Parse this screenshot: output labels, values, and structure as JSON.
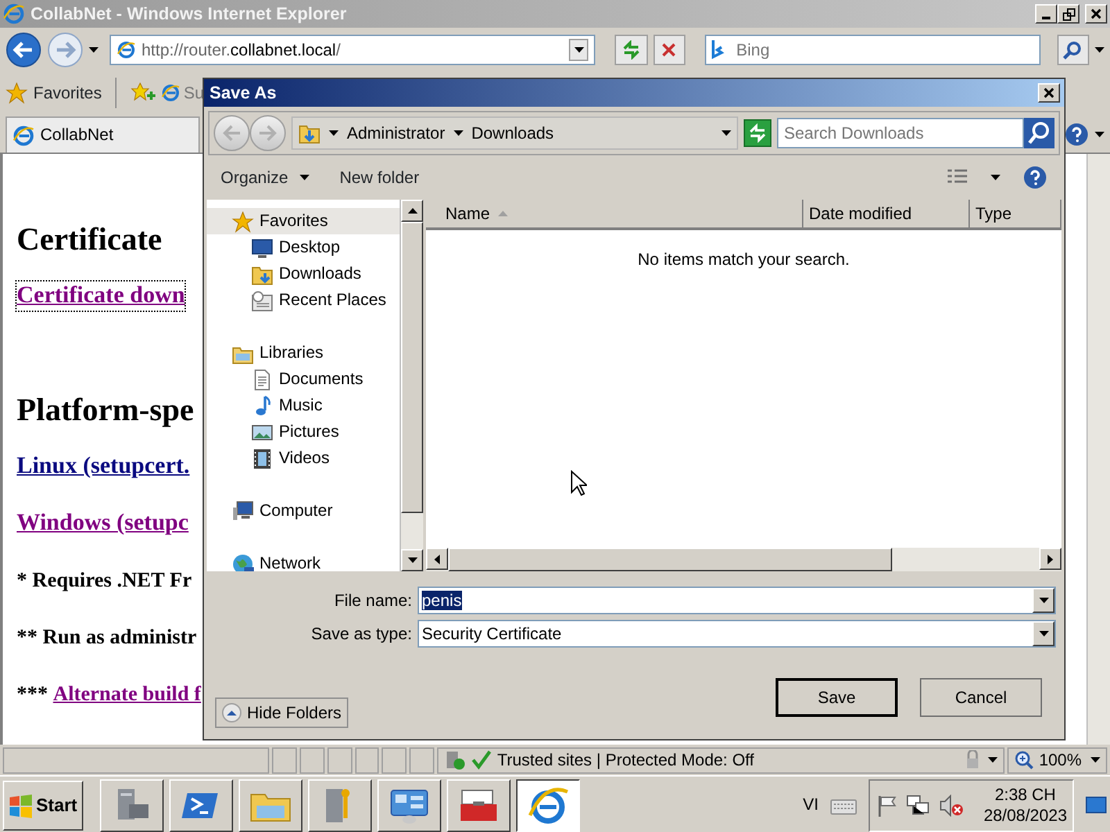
{
  "window": {
    "title": "CollabNet - Windows Internet Explorer"
  },
  "address_bar": {
    "url_prefix": "http://router.",
    "url_domain": "collabnet.local",
    "url_suffix": "/"
  },
  "search": {
    "placeholder": "Bing"
  },
  "favorites_bar": {
    "label": "Favorites",
    "items": [
      "Su"
    ]
  },
  "tabs": [
    {
      "label": "CollabNet",
      "selected": true
    }
  ],
  "page": {
    "blocks": [
      {
        "kind": "heading",
        "text": "Certificate"
      },
      {
        "kind": "link",
        "text": "Certificate down",
        "visited": true,
        "focused": true
      },
      {
        "kind": "heading",
        "text": "Platform-spe"
      },
      {
        "kind": "link",
        "text": "Linux (setupcert.",
        "visited": false,
        "focused": false
      },
      {
        "kind": "link",
        "text": "Windows (setupc",
        "visited": true,
        "focused": false
      },
      {
        "kind": "note",
        "text": "* Requires .NET Fr"
      },
      {
        "kind": "note",
        "text": "** Run as administr"
      },
      {
        "kind": "note",
        "text": "*** ",
        "link": "Alternate build f"
      }
    ]
  },
  "dialog": {
    "title": "Save As",
    "breadcrumb": [
      "Administrator",
      "Downloads"
    ],
    "search": {
      "placeholder": "Search Downloads"
    },
    "toolbar": [
      {
        "label": "Organize",
        "dropdown": true
      },
      {
        "label": "New folder",
        "dropdown": false
      }
    ],
    "nav_tree": [
      {
        "label": "Favorites",
        "kind": "star",
        "selected": true,
        "children": [
          {
            "label": "Desktop",
            "kind": "desktop",
            "selected": false
          },
          {
            "label": "Downloads",
            "kind": "downloads",
            "selected": false
          },
          {
            "label": "Recent Places",
            "kind": "recent",
            "selected": false
          }
        ]
      },
      {
        "label": "Libraries",
        "kind": "libraries",
        "selected": false,
        "children": [
          {
            "label": "Documents",
            "kind": "documents",
            "selected": false
          },
          {
            "label": "Music",
            "kind": "music",
            "selected": false
          },
          {
            "label": "Pictures",
            "kind": "pictures",
            "selected": false
          },
          {
            "label": "Videos",
            "kind": "videos",
            "selected": false
          }
        ]
      },
      {
        "label": "Computer",
        "kind": "computer",
        "selected": false
      },
      {
        "label": "Network",
        "kind": "network",
        "selected": false
      }
    ],
    "columns": [
      {
        "label": "Name",
        "sorted": true
      },
      {
        "label": "Date modified",
        "sorted": false
      },
      {
        "label": "Type",
        "sorted": false
      }
    ],
    "empty_message": "No items match your search.",
    "file_name": {
      "label": "File name:",
      "value": "penis"
    },
    "save_type": {
      "label": "Save as type:",
      "value": "Security Certificate"
    },
    "hide_folders": "Hide Folders",
    "buttons": [
      {
        "label": "Save",
        "default": true
      },
      {
        "label": "Cancel",
        "default": false
      }
    ]
  },
  "status_bar": {
    "zone": "Trusted sites | Protected Mode: Off",
    "zoom": "100%"
  },
  "taskbar": {
    "start": "Start",
    "apps": [
      {
        "kind": "server",
        "active": false
      },
      {
        "kind": "shell",
        "active": false
      },
      {
        "kind": "folder",
        "active": false
      },
      {
        "kind": "tools",
        "active": false
      },
      {
        "kind": "panel",
        "active": false
      },
      {
        "kind": "toolbox",
        "active": false
      },
      {
        "kind": "browser",
        "active": true
      }
    ],
    "language": "VI",
    "time": "2:38 CH",
    "date": "28/08/2023"
  }
}
